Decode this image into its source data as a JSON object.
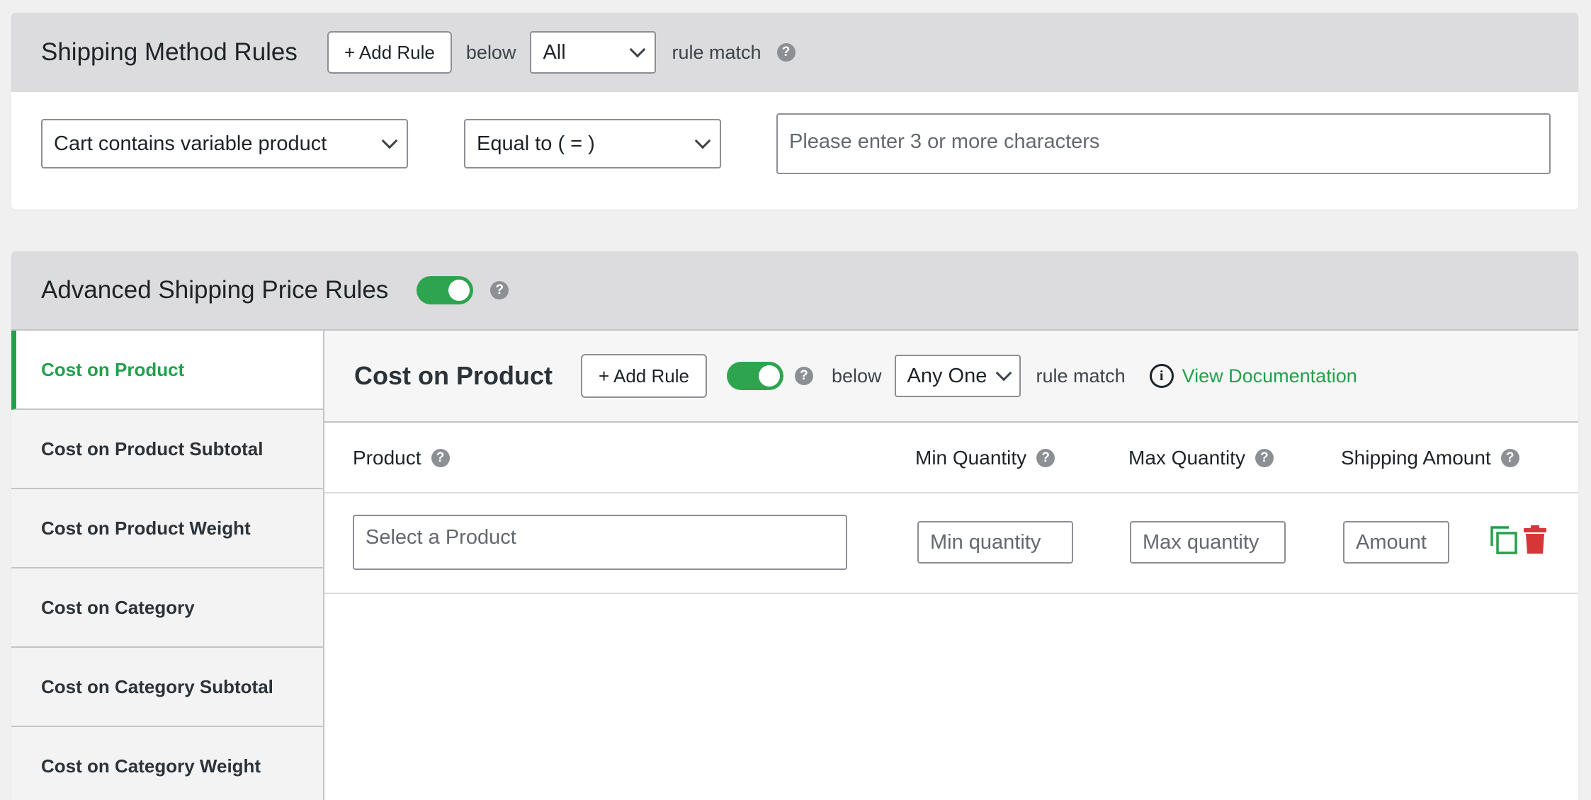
{
  "method_rules": {
    "title": "Shipping Method Rules",
    "add_rule_label": "+ Add Rule",
    "below_text": "below",
    "match_select": "All",
    "rule_match_text": "rule match",
    "help_glyph": "?",
    "condition_select": "Cart contains variable product",
    "operator_select": "Equal to ( = )",
    "value_placeholder": "Please enter 3 or more characters"
  },
  "price_rules": {
    "title": "Advanced Shipping Price Rules",
    "enabled": true,
    "help_glyph": "?",
    "sidebar": {
      "items": [
        {
          "label": "Cost on Product",
          "active": true
        },
        {
          "label": "Cost on Product Subtotal",
          "active": false
        },
        {
          "label": "Cost on Product Weight",
          "active": false
        },
        {
          "label": "Cost on Category",
          "active": false
        },
        {
          "label": "Cost on Category Subtotal",
          "active": false
        },
        {
          "label": "Cost on Category Weight",
          "active": false
        }
      ]
    },
    "content": {
      "title": "Cost on Product",
      "add_rule_label": "+ Add Rule",
      "enabled": true,
      "below_text": "below",
      "match_select": "Any One",
      "rule_match_text": "rule match",
      "info_glyph": "i",
      "doc_link": "View Documentation",
      "columns": {
        "product": "Product",
        "min_qty": "Min Quantity",
        "max_qty": "Max Quantity",
        "amount": "Shipping Amount"
      },
      "row": {
        "product_placeholder": "Select a Product",
        "min_placeholder": "Min quantity",
        "max_placeholder": "Max quantity",
        "amount_placeholder": "Amount"
      }
    }
  },
  "colors": {
    "accent_green": "#22a04b",
    "toggle_green": "#2ea44f",
    "delete_red": "#d63638"
  },
  "icons": [
    "help-icon",
    "chevron-down-icon",
    "info-icon",
    "copy-icon",
    "trash-icon"
  ]
}
